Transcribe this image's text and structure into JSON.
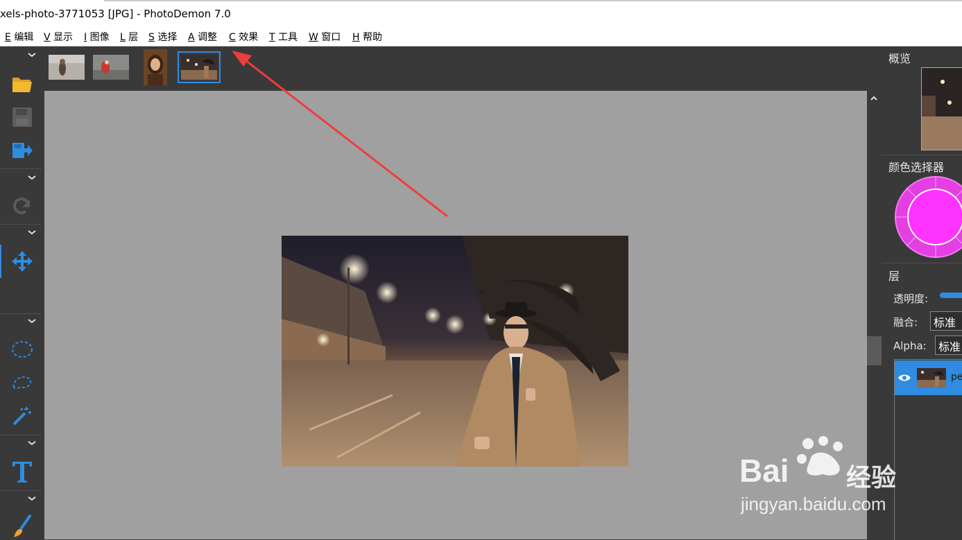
{
  "window": {
    "title": "xels-photo-3771053 [JPG]  -  PhotoDemon 7.0"
  },
  "menu": [
    {
      "key": "E",
      "label": "编辑"
    },
    {
      "key": "V",
      "label": "显示"
    },
    {
      "key": "I",
      "label": "图像"
    },
    {
      "key": "L",
      "label": "层"
    },
    {
      "key": "S",
      "label": "选择"
    },
    {
      "key": "A",
      "label": "调整"
    },
    {
      "key": "C",
      "label": "效果"
    },
    {
      "key": "T",
      "label": "工具"
    },
    {
      "key": "W",
      "label": "窗口"
    },
    {
      "key": "H",
      "label": "帮助"
    }
  ],
  "toolbox": {
    "icons": [
      "open-folder-icon",
      "save-icon",
      "export-icon",
      "redo-icon",
      "move-icon",
      "ellipse-select-icon",
      "lasso-select-icon",
      "magic-wand-icon",
      "text-tool-icon",
      "paintbrush-icon"
    ],
    "accent": "#2f8ce0"
  },
  "thumbnails": [
    {
      "name": "thumb-1",
      "selected": false
    },
    {
      "name": "thumb-2",
      "selected": false
    },
    {
      "name": "thumb-3",
      "selected": false
    },
    {
      "name": "thumb-4",
      "selected": true
    }
  ],
  "right_panel": {
    "overview_title": "概览",
    "color_picker_title": "颜色选择器",
    "color_current": "#ff33ff",
    "layers_title": "层",
    "opacity_label": "透明度:",
    "blend_label": "融合:",
    "blend_value": "标准",
    "alpha_label": "Alpha:",
    "alpha_value": "标准",
    "layer_name": "pe"
  },
  "watermark": {
    "brand": "Bai",
    "brand2": "经验",
    "url": "jingyan.baidu.com"
  },
  "colors": {
    "canvas_bg": "#a0a0a0",
    "panel_bg": "#393939",
    "selection": "#2f8ce0",
    "annotation_arrow": "#f03c3c"
  }
}
